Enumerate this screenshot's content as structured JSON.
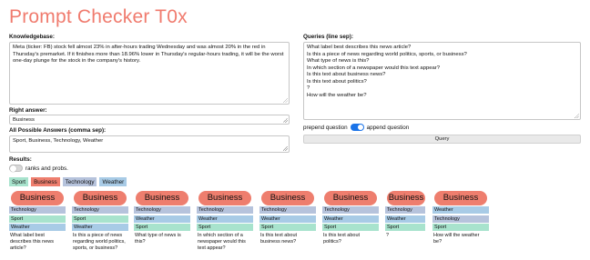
{
  "app": {
    "title": "Prompt Checker T0x"
  },
  "colors": {
    "Business": "#ee7e6e",
    "Technology": "#b6c3dc",
    "Sport": "#a8e3cd",
    "Weather": "#a8cbe6"
  },
  "knowledgebase": {
    "label": "Knowledgebase:",
    "value": "Meta (ticker: FB) stock fell almost 23% in after-hours trading Wednesday and was almost 20% in the red in Thursday's premarket. If it finishes more than 18.96% lower in Thursday's regular-hours trading, it will be the worst one-day plunge for the stock in the company's history."
  },
  "right_answer": {
    "label": "Right answer:",
    "value": "Business"
  },
  "possible_answers": {
    "label": "All Possible Answers (comma sep):",
    "value": "Sport, Business, Technology, Weather"
  },
  "queries": {
    "label": "Queries (line sep):",
    "lines": [
      "What label best describes this news article?",
      "Is this a piece of news regarding world politics, sports, or business?",
      "What type of news is this?",
      "In which section of a newspaper would this text appear?",
      "Is this text about business news?",
      "Is this text about politics?",
      "?",
      "How will the weather be?"
    ]
  },
  "prepend_toggle": {
    "left_label": "prepend question",
    "right_label": "append question",
    "state": "on"
  },
  "query_button": {
    "label": "Query"
  },
  "results": {
    "label": "Results:",
    "ranks_label": "ranks and probs.",
    "ranks_state": "off"
  },
  "legend": [
    "Sport",
    "Business",
    "Technology",
    "Weather"
  ],
  "result_cards": [
    {
      "top": "Business",
      "ranks": [
        "Technology",
        "Sport",
        "Weather"
      ],
      "question": "What label best describes this news article?"
    },
    {
      "top": "Business",
      "ranks": [
        "Technology",
        "Sport",
        "Weather"
      ],
      "question": "Is this a piece of news regarding world politics, sports, or business?"
    },
    {
      "top": "Business",
      "ranks": [
        "Technology",
        "Weather",
        "Sport"
      ],
      "question": "What type of news is this?"
    },
    {
      "top": "Business",
      "ranks": [
        "Technology",
        "Weather",
        "Sport"
      ],
      "question": "In which section of a newspaper would this text appear?"
    },
    {
      "top": "Business",
      "ranks": [
        "Technology",
        "Weather",
        "Sport"
      ],
      "question": "Is this text about business news?"
    },
    {
      "top": "Business",
      "ranks": [
        "Technology",
        "Weather",
        "Sport"
      ],
      "question": "Is this text about politics?"
    },
    {
      "top": "Business",
      "ranks": [
        "Technology",
        "Weather",
        "Sport"
      ],
      "question": "?"
    },
    {
      "top": "Business",
      "ranks": [
        "Weather",
        "Technology",
        "Sport"
      ],
      "question": "How will the weather be?"
    }
  ]
}
